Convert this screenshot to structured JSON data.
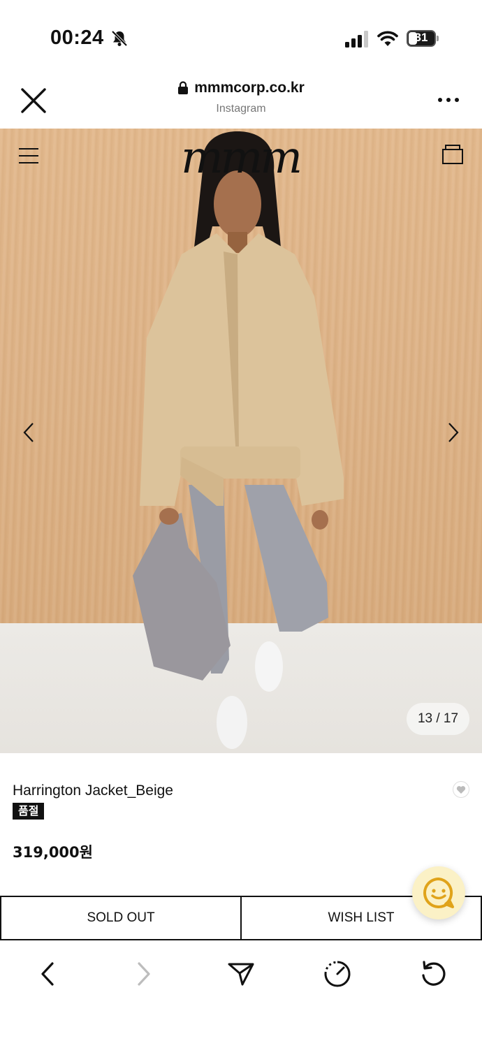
{
  "status_bar": {
    "time": "00:24",
    "battery": "31",
    "icons": [
      "bell-slash-icon",
      "cellular-signal-icon",
      "wifi-icon",
      "battery-icon"
    ]
  },
  "browser": {
    "domain": "mmmcorp.co.kr",
    "source": "Instagram"
  },
  "site": {
    "logo": "mmm"
  },
  "gallery": {
    "counter": "13 / 17"
  },
  "product": {
    "name": "Harrington Jacket_Beige",
    "badge": "품절",
    "price": "319,000원"
  },
  "actions": {
    "sold_out": "SOLD OUT",
    "wish_list": "WISH LIST"
  },
  "colors": {
    "text": "#111111",
    "chat_bg": "#fbf1c6",
    "chat_icon": "#e0a31a",
    "forward_disabled": "#bdbdbd"
  }
}
